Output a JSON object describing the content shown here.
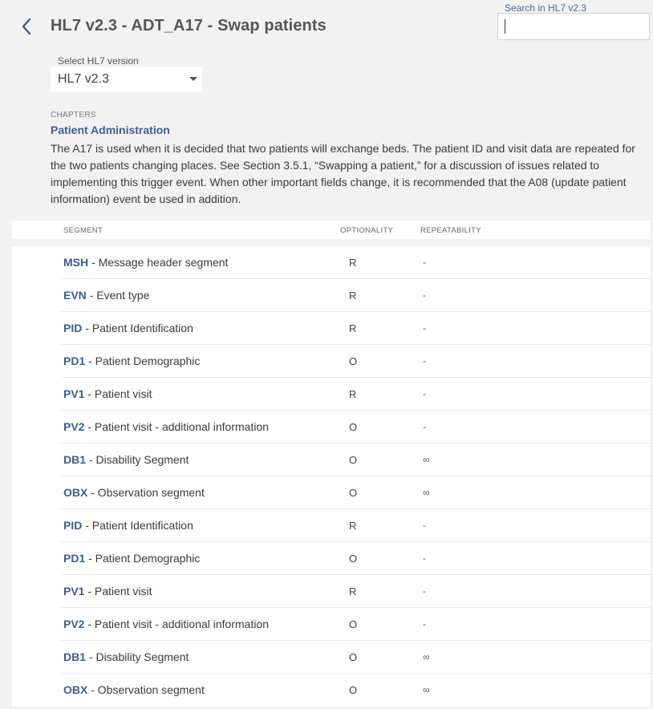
{
  "header": {
    "title": "HL7 v2.3 - ADT_A17 - Swap patients",
    "back_icon": "chevron-left-icon"
  },
  "search": {
    "label": "Search in HL7 v2.3",
    "value": ""
  },
  "version": {
    "label": "Select HL7 version",
    "selected": "HL7 v2.3"
  },
  "chapters": {
    "label": "CHAPTERS",
    "link": "Patient Administration",
    "description": "The A17 is used when it is decided that two patients will exchange beds. The patient ID and visit data are repeated for the two patients changing places. See Section 3.5.1, “Swapping a patient,” for a discussion of issues related to implementing this trigger event. When other important fields change, it is recommended that the A08 (update patient information) event be used in addition."
  },
  "table": {
    "columns": [
      "SEGMENT",
      "OPTIONALITY",
      "REPEATABILITY"
    ],
    "rows": [
      {
        "code": "MSH",
        "name": " - Message header segment",
        "optionality": "R",
        "repeatability": "-"
      },
      {
        "code": "EVN",
        "name": " - Event type",
        "optionality": "R",
        "repeatability": "-"
      },
      {
        "code": "PID",
        "name": " - Patient Identification",
        "optionality": "R",
        "repeatability": "-"
      },
      {
        "code": "PD1",
        "name": " - Patient Demographic",
        "optionality": "O",
        "repeatability": "-"
      },
      {
        "code": "PV1",
        "name": " - Patient visit",
        "optionality": "R",
        "repeatability": "-"
      },
      {
        "code": "PV2",
        "name": " - Patient visit - additional information",
        "optionality": "O",
        "repeatability": "-"
      },
      {
        "code": "DB1",
        "name": " - Disability Segment",
        "optionality": "O",
        "repeatability": "∞"
      },
      {
        "code": "OBX",
        "name": " - Observation segment",
        "optionality": "O",
        "repeatability": "∞"
      },
      {
        "code": "PID",
        "name": " - Patient Identification",
        "optionality": "R",
        "repeatability": "-"
      },
      {
        "code": "PD1",
        "name": " - Patient Demographic",
        "optionality": "O",
        "repeatability": "-"
      },
      {
        "code": "PV1",
        "name": " - Patient visit",
        "optionality": "R",
        "repeatability": "-"
      },
      {
        "code": "PV2",
        "name": " - Patient visit - additional information",
        "optionality": "O",
        "repeatability": "-"
      },
      {
        "code": "DB1",
        "name": " - Disability Segment",
        "optionality": "O",
        "repeatability": "∞"
      },
      {
        "code": "OBX",
        "name": " - Observation segment",
        "optionality": "O",
        "repeatability": "∞"
      }
    ]
  },
  "colors": {
    "accent": "#3b5f93",
    "background": "#f2f2f2"
  }
}
